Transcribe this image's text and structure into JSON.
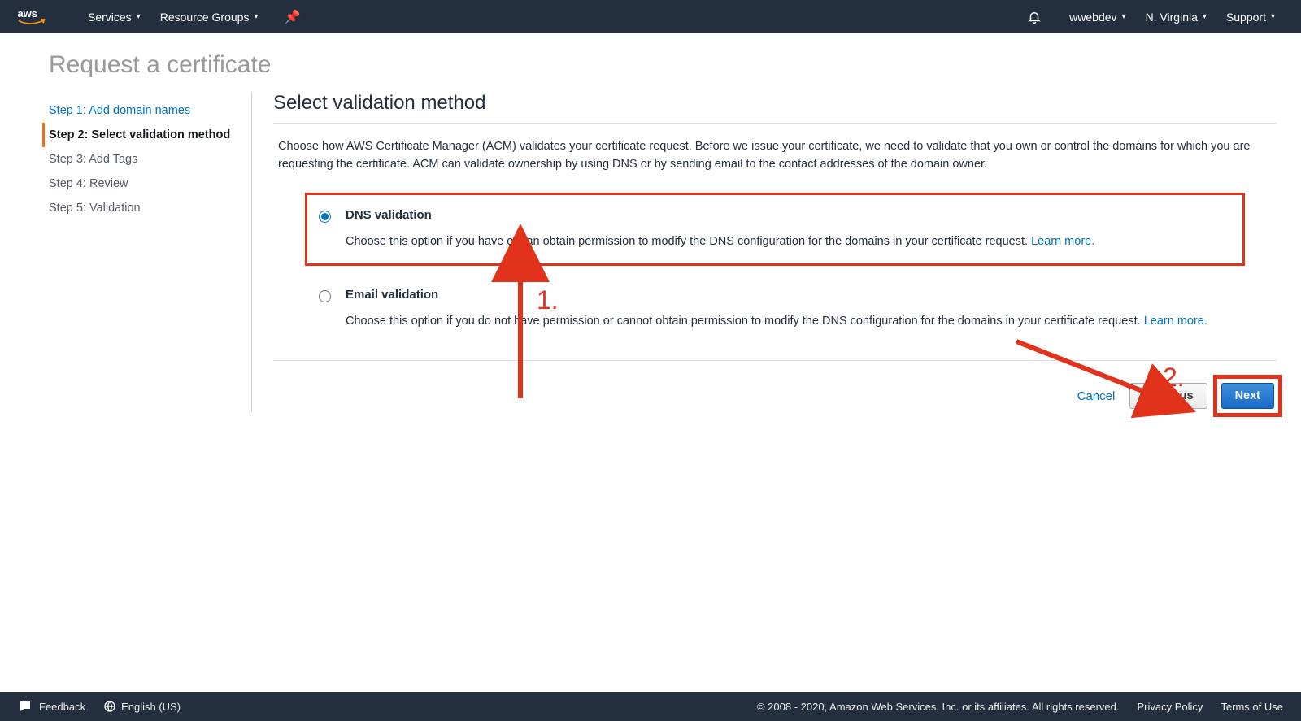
{
  "topnav": {
    "logo_text": "aws",
    "services": "Services",
    "resource_groups": "Resource Groups",
    "account": "wwebdev",
    "region": "N. Virginia",
    "support": "Support"
  },
  "page_title": "Request a certificate",
  "steps": [
    {
      "label": "Step 1: Add domain names",
      "state": "link"
    },
    {
      "label": "Step 2: Select validation method",
      "state": "active"
    },
    {
      "label": "Step 3: Add Tags",
      "state": "disabled"
    },
    {
      "label": "Step 4: Review",
      "state": "disabled"
    },
    {
      "label": "Step 5: Validation",
      "state": "disabled"
    }
  ],
  "section": {
    "title": "Select validation method",
    "description": "Choose how AWS Certificate Manager (ACM) validates your certificate request. Before we issue your certificate, we need to validate that you own or control the domains for which you are requesting the certificate. ACM can validate ownership by using DNS or by sending email to the contact addresses of the domain owner."
  },
  "options": {
    "dns": {
      "title": "DNS validation",
      "desc_before": "Choose this option if you have or can obtain permission to modify the DNS configuration for the domains in your certificate request. ",
      "learn_more": "Learn more."
    },
    "email": {
      "title": "Email validation",
      "desc_before": "Choose this option if you do not have permission or cannot obtain permission to modify the DNS configuration for the domains in your certificate request. ",
      "learn_more": "Learn more."
    }
  },
  "buttons": {
    "cancel": "Cancel",
    "previous": "Previous",
    "next": "Next"
  },
  "footer": {
    "feedback": "Feedback",
    "language": "English (US)",
    "copyright": "© 2008 - 2020, Amazon Web Services, Inc. or its affiliates. All rights reserved.",
    "privacy": "Privacy Policy",
    "terms": "Terms of Use"
  },
  "annotations": {
    "label1": "1.",
    "label2": "2."
  }
}
